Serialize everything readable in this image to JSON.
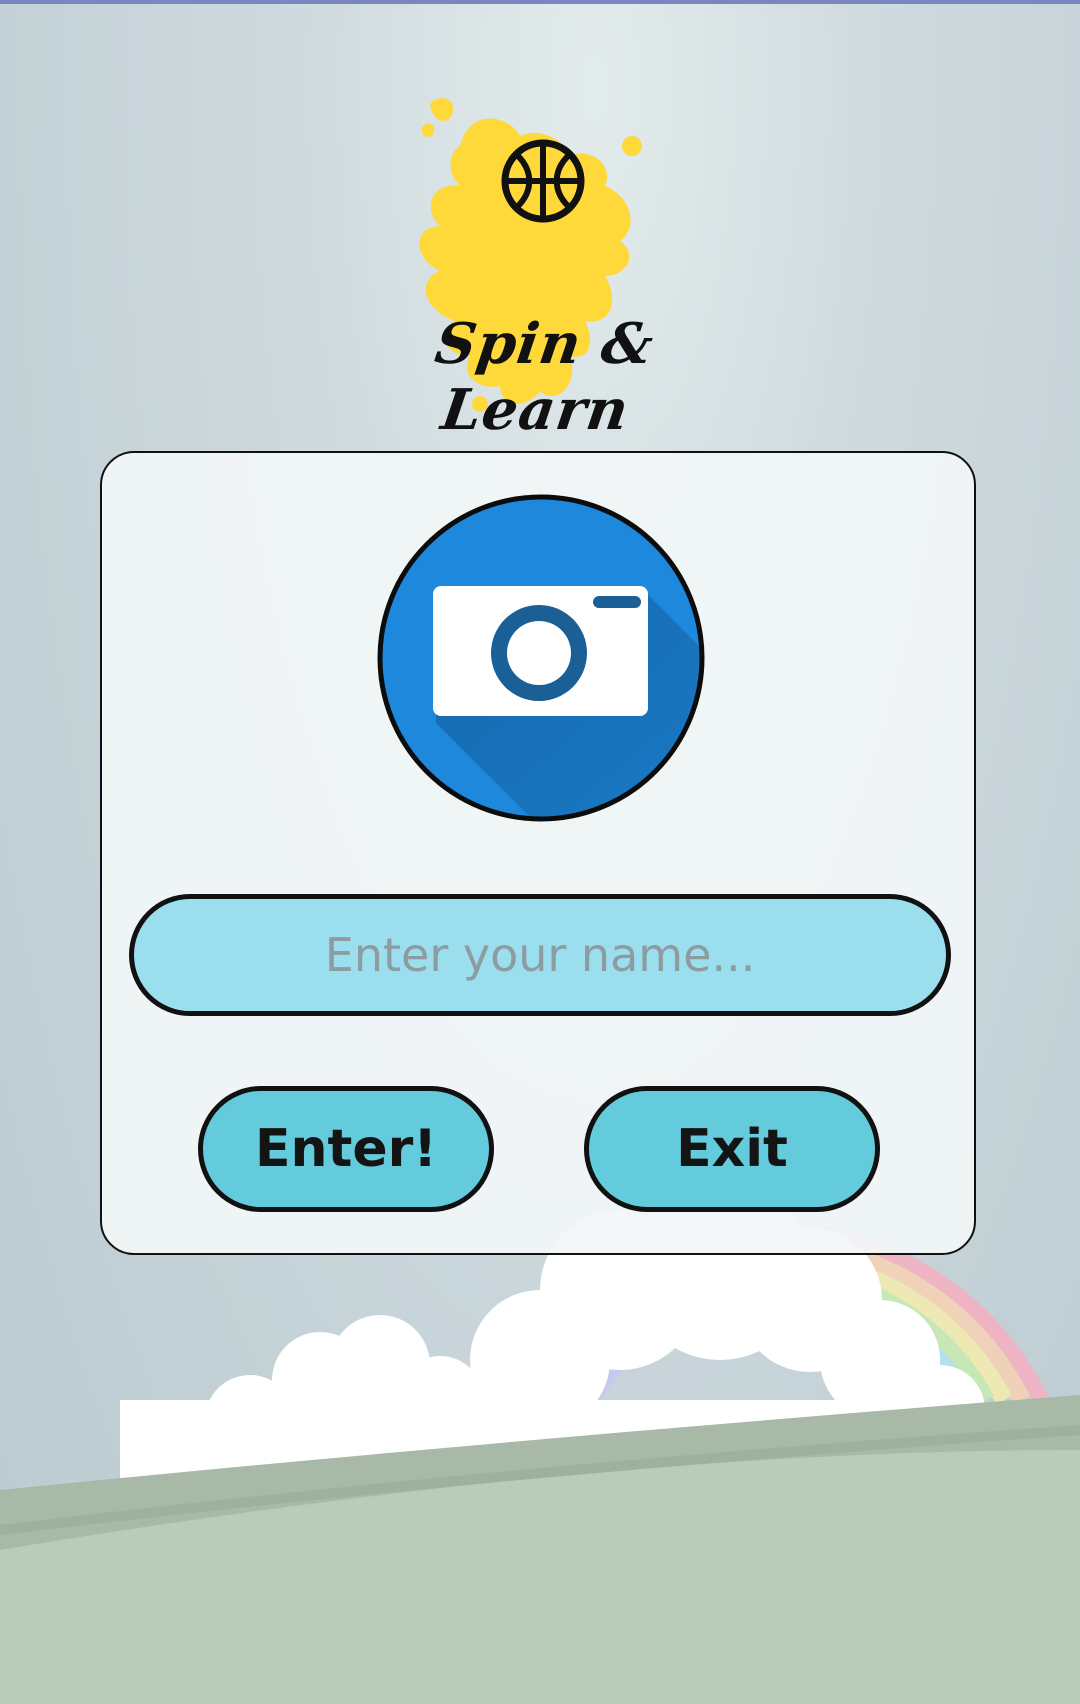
{
  "logo": {
    "title": "Spin & Learn",
    "icon": "basketball-icon"
  },
  "card": {
    "camera": {
      "icon": "camera-icon"
    },
    "name_input": {
      "placeholder": "Enter your name...",
      "value": ""
    },
    "enter_button": {
      "label": "Enter!"
    },
    "exit_button": {
      "label": "Exit"
    }
  },
  "colors": {
    "splash": "#ffd83a",
    "camera_circle": "#1e88dc",
    "input_fill": "#9bdeee",
    "button_fill": "#63cbdb",
    "hill": "#a9bba9"
  }
}
